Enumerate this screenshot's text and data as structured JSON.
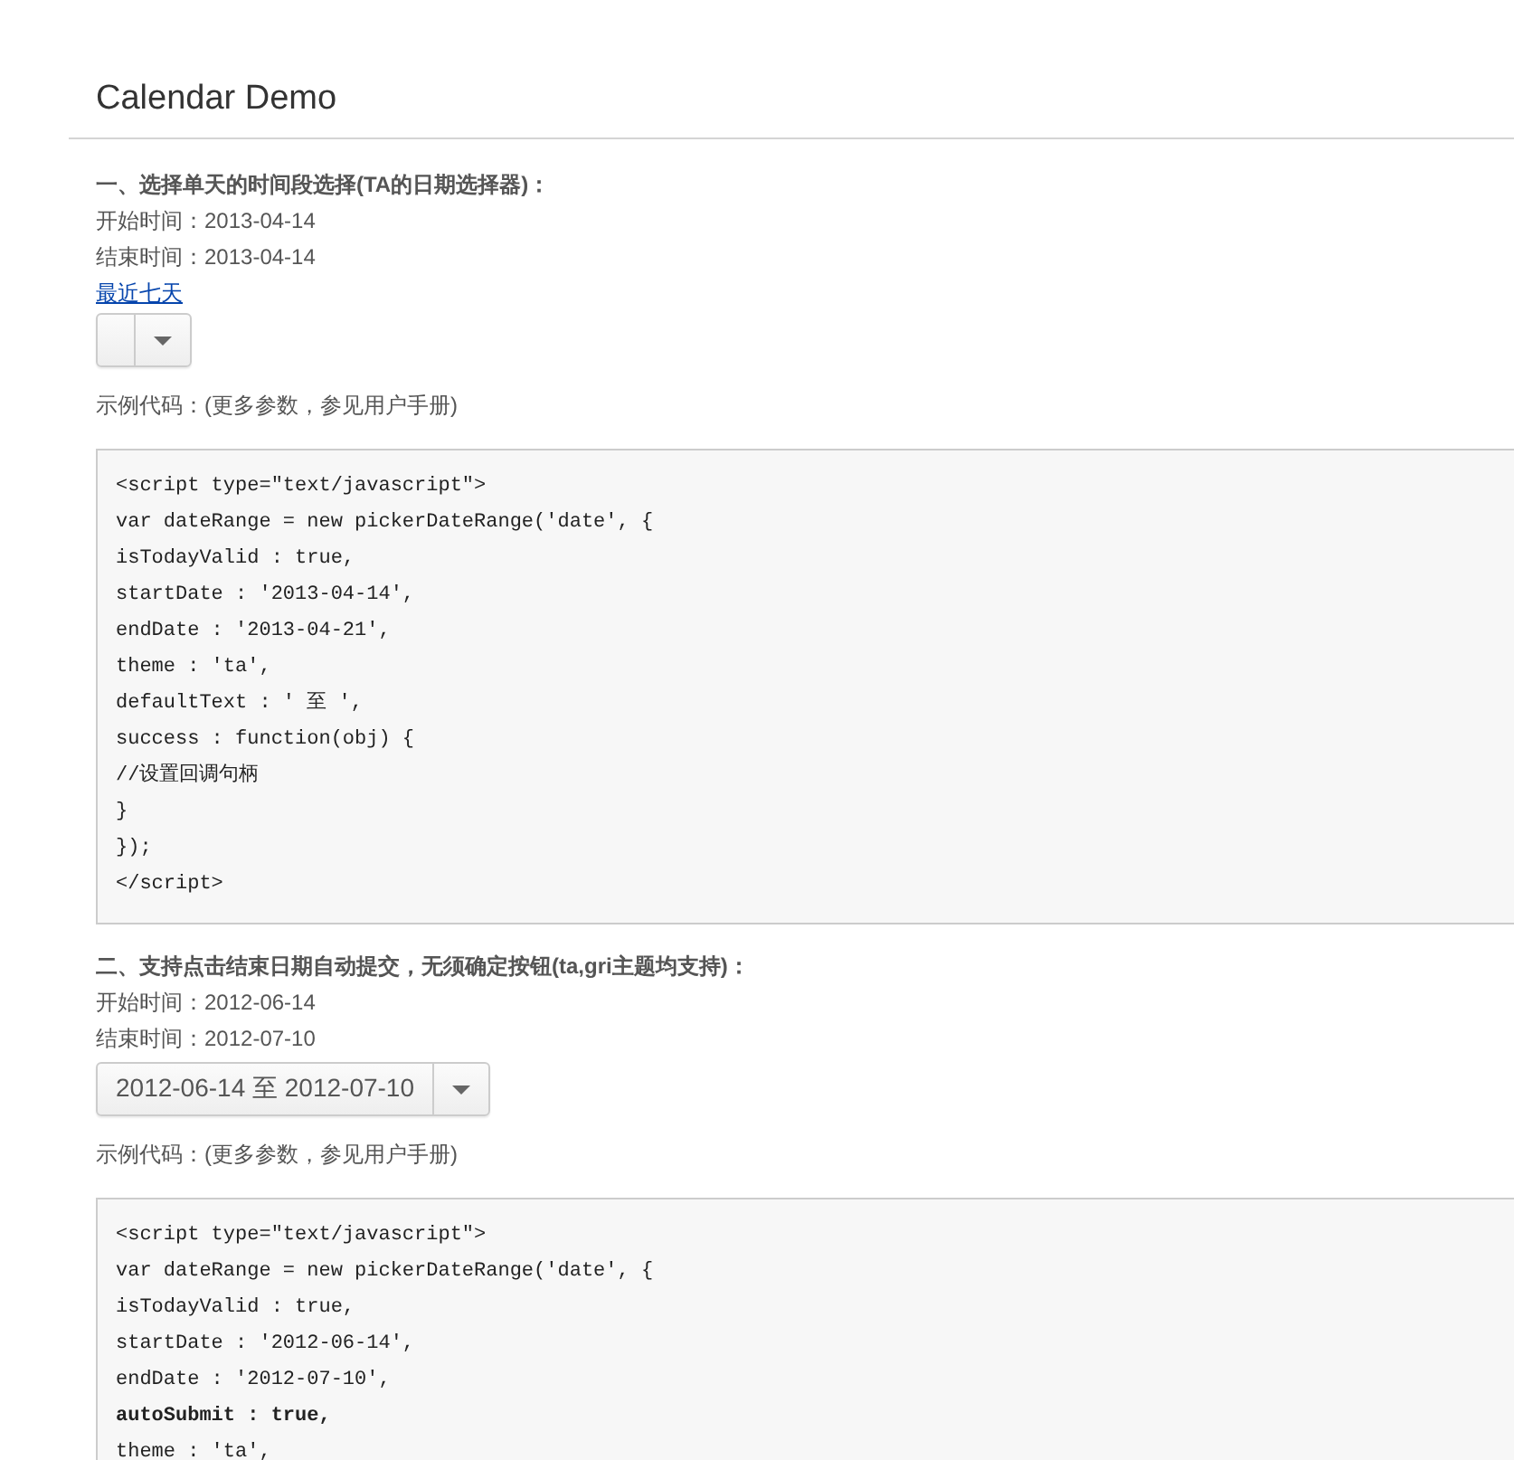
{
  "title": "Calendar Demo",
  "sections": [
    {
      "heading": "一、选择单天的时间段选择(TA的日期选择器)：",
      "start": "开始时间：2013-04-14",
      "end": "结束时间：2013-04-14",
      "link": "最近七天",
      "picker": {
        "kind": "empty"
      },
      "code_label": "示例代码：(更多参数，参见用户手册)",
      "code": [
        {
          "text": "<script type=\"text/javascript\">",
          "bold": false
        },
        {
          "text": "var dateRange = new pickerDateRange('date', {",
          "bold": false
        },
        {
          "text": "isTodayValid : true,",
          "bold": false
        },
        {
          "text": "startDate : '2013-04-14',",
          "bold": false
        },
        {
          "text": "endDate : '2013-04-21',",
          "bold": false
        },
        {
          "text": "theme : 'ta',",
          "bold": false
        },
        {
          "text": "defaultText : ' 至 ',",
          "bold": false
        },
        {
          "text": "success : function(obj) {",
          "bold": false
        },
        {
          "text": "//设置回调句柄",
          "bold": false
        },
        {
          "text": "}",
          "bold": false
        },
        {
          "text": "});",
          "bold": false
        },
        {
          "text": "</script>",
          "bold": false
        }
      ]
    },
    {
      "heading": "二、支持点击结束日期自动提交，无须确定按钮(ta,gri主题均支持)：",
      "start": "开始时间：2012-06-14",
      "end": "结束时间：2012-07-10",
      "picker": {
        "kind": "filled",
        "value": "2012-06-14 至 2012-07-10"
      },
      "code_label": "示例代码：(更多参数，参见用户手册)",
      "code": [
        {
          "text": "<script type=\"text/javascript\">",
          "bold": false
        },
        {
          "text": "var dateRange = new pickerDateRange('date', {",
          "bold": false
        },
        {
          "text": "isTodayValid : true,",
          "bold": false
        },
        {
          "text": "startDate : '2012-06-14',",
          "bold": false
        },
        {
          "text": "endDate : '2012-07-10',",
          "bold": false
        },
        {
          "text": "autoSubmit : true,",
          "bold": true
        },
        {
          "text": "theme : 'ta',",
          "bold": false
        }
      ]
    }
  ]
}
